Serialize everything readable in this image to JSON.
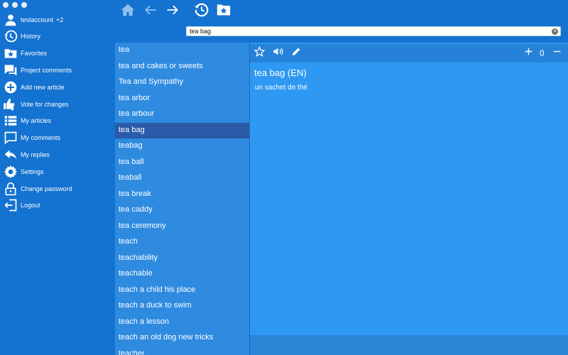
{
  "sidebar": {
    "user": {
      "name": "testaccount",
      "extra": "+2"
    },
    "items": [
      {
        "label": "History",
        "icon": "history-icon"
      },
      {
        "label": "Favorites",
        "icon": "favorites-icon"
      },
      {
        "label": "Project comments",
        "icon": "comments-icon"
      },
      {
        "label": "Add new article",
        "icon": "add-icon"
      },
      {
        "label": "Vote for changes",
        "icon": "vote-icon"
      },
      {
        "label": "My articles",
        "icon": "list-icon"
      },
      {
        "label": "My comments",
        "icon": "comment-icon"
      },
      {
        "label": "My replies",
        "icon": "reply-icon"
      },
      {
        "label": "Settings",
        "icon": "gear-icon"
      },
      {
        "label": "Change password",
        "icon": "lock-icon"
      },
      {
        "label": "Logout",
        "icon": "logout-icon"
      }
    ]
  },
  "toolbar": {
    "icons": [
      "home-icon",
      "back-arrow-icon",
      "forward-arrow-icon",
      "history-icon",
      "favorites-folder-icon"
    ]
  },
  "search": {
    "value": "tea bag",
    "placeholder": ""
  },
  "word_list": {
    "items": [
      "tea",
      "tea and cakes or sweets",
      "Tea and Sympathy",
      "tea arbor",
      "tea arbour",
      "tea bag",
      "teabag",
      "tea ball",
      "teaball",
      "tea break",
      "tea caddy",
      "tea ceremony",
      "teach",
      "teachability",
      "teachable",
      "teach a child his place",
      "teach a duck to swim",
      "teach a lesson",
      "teach an old dog new tricks",
      "teacher"
    ],
    "selected": "tea bag"
  },
  "article": {
    "title": "tea bag (EN)",
    "translation": "un sachet de thé",
    "vote_count": "0",
    "icons": [
      "star-icon",
      "speaker-icon",
      "pencil-icon",
      "plus-icon",
      "minus-icon"
    ]
  },
  "colors": {
    "sidebar": "#1472d0",
    "list_bg": "#2e8be0",
    "selected": "#2b5ba8",
    "detail_bg": "#2f98f2"
  }
}
